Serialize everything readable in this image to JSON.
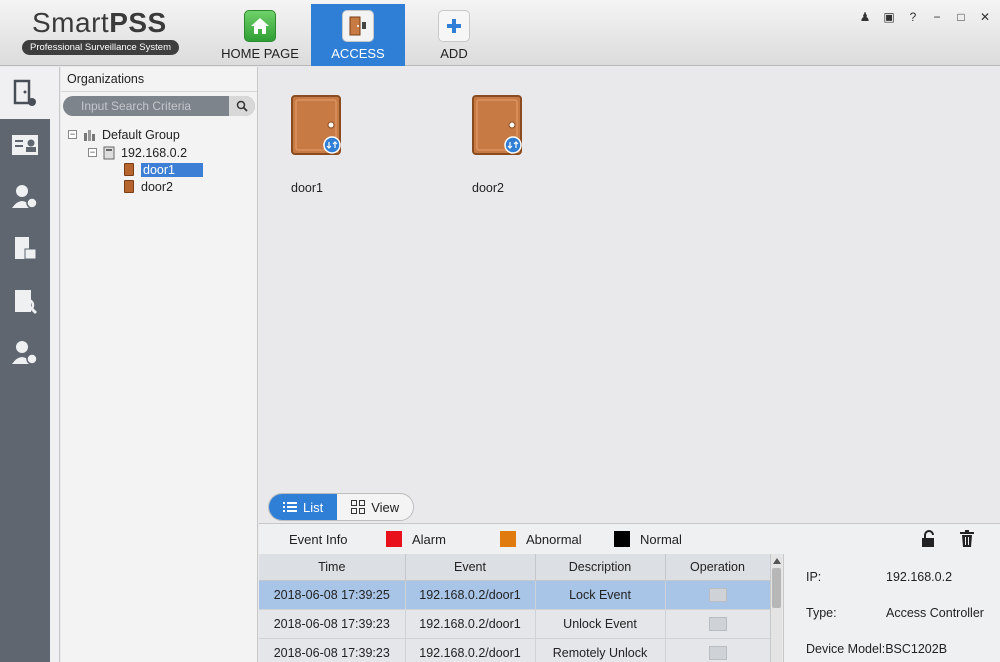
{
  "app": {
    "logo_title_a": "Smart",
    "logo_title_b": "PSS",
    "logo_subtitle": "Professional Surveillance System"
  },
  "nav": {
    "tabs": [
      {
        "label": "HOME PAGE",
        "icon": "home-icon"
      },
      {
        "label": "ACCESS",
        "icon": "door-icon",
        "active": true
      },
      {
        "label": "ADD",
        "icon": "plus-icon"
      }
    ]
  },
  "window_controls": {
    "user": "♟",
    "lock": "▣",
    "help": "?",
    "minimize": "−",
    "maximize": "□",
    "close": "✕"
  },
  "sidebar_rail": {
    "items": [
      "door-access-icon",
      "user-card-icon",
      "user-settings-icon",
      "door-lock-icon",
      "record-search-icon",
      "user-time-icon"
    ]
  },
  "organizations": {
    "title": "Organizations",
    "search_placeholder": "Input Search Criteria",
    "tree": {
      "group": "Default Group",
      "device": "192.168.0.2",
      "doors": [
        "door1",
        "door2"
      ],
      "selected": "door1"
    }
  },
  "doors": [
    {
      "name": "door1"
    },
    {
      "name": "door2"
    }
  ],
  "view_toggle": {
    "list_label": "List",
    "view_label": "View",
    "active": "List"
  },
  "legend": {
    "event_info": "Event Info",
    "items": [
      {
        "label": "Alarm",
        "color": "#e8111b"
      },
      {
        "label": "Abnormal",
        "color": "#e07b10"
      },
      {
        "label": "Normal",
        "color": "#000000"
      }
    ]
  },
  "event_table": {
    "columns": [
      "Time",
      "Event",
      "Description",
      "Operation"
    ],
    "rows": [
      {
        "time": "2018-06-08 17:39:25",
        "event": "192.168.0.2/door1",
        "description": "Lock Event",
        "selected": true
      },
      {
        "time": "2018-06-08 17:39:23",
        "event": "192.168.0.2/door1",
        "description": "Unlock Event"
      },
      {
        "time": "2018-06-08 17:39:23",
        "event": "192.168.0.2/door1",
        "description": "Remotely Unlock"
      }
    ]
  },
  "device_info": {
    "ip_label": "IP:",
    "ip_value": "192.168.0.2",
    "type_label": "Type:",
    "type_value": "Access Controller",
    "model_label": "Device Model:",
    "model_value": "BSC1202B"
  },
  "colors": {
    "accent": "#2f7fd6",
    "rail": "#5f6670",
    "door": "#c87a45"
  }
}
